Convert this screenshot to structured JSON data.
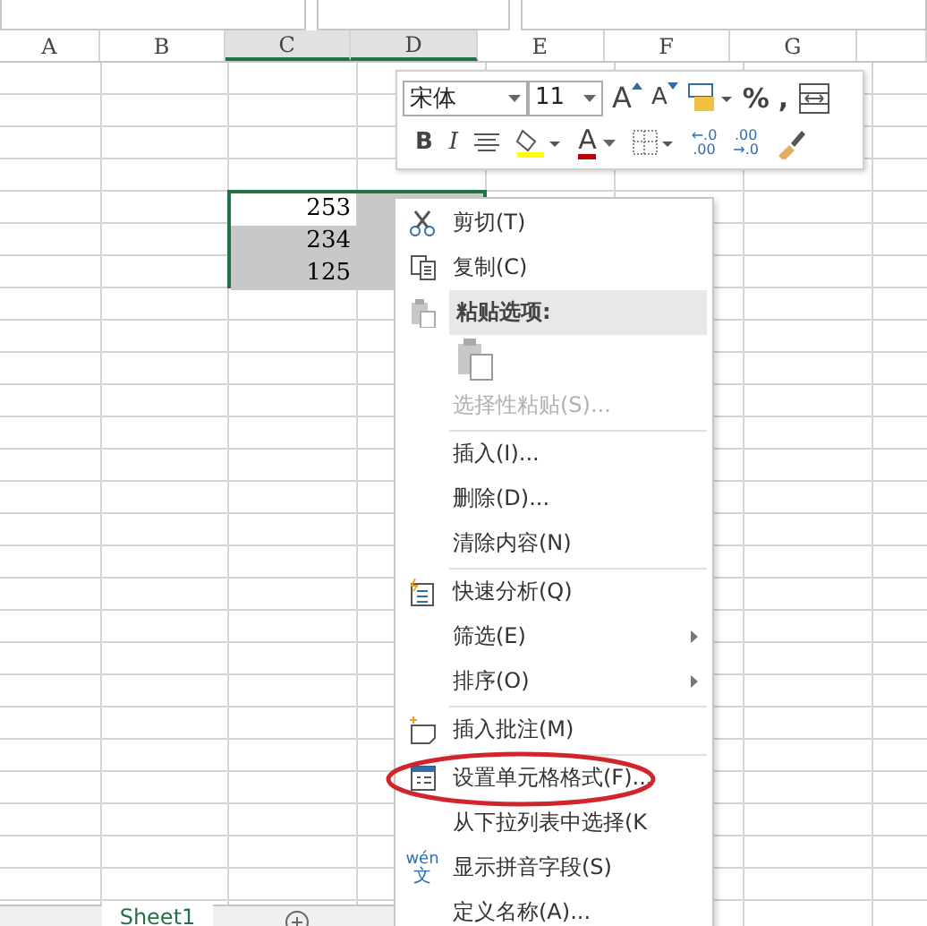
{
  "columns": [
    {
      "label": "A",
      "selected": false
    },
    {
      "label": "B",
      "selected": false
    },
    {
      "label": "C",
      "selected": true
    },
    {
      "label": "D",
      "selected": true
    },
    {
      "label": "E",
      "selected": false
    },
    {
      "label": "F",
      "selected": false
    },
    {
      "label": "G",
      "selected": false
    }
  ],
  "selected_cells": [
    {
      "value": "253",
      "active": true
    },
    {
      "value": "234",
      "active": false
    },
    {
      "value": "125",
      "active": false
    }
  ],
  "mini_toolbar": {
    "font": "宋体",
    "size": "11",
    "row_1": [
      {
        "kind": "grow",
        "label": "A"
      },
      {
        "kind": "shrink",
        "label": "A"
      },
      {
        "kind": "styles"
      },
      {
        "kind": "percent",
        "label": "%"
      },
      {
        "kind": "comma",
        "label": ","
      },
      {
        "kind": "wrap"
      }
    ],
    "row_2": [
      {
        "kind": "bold",
        "label": "B"
      },
      {
        "kind": "italic",
        "label": "I"
      },
      {
        "kind": "align"
      },
      {
        "kind": "fill"
      },
      {
        "kind": "font_color",
        "label": "A"
      },
      {
        "kind": "borders"
      },
      {
        "kind": "decimal_more",
        "top": "←.0",
        "bottom": ".00"
      },
      {
        "kind": "decimal_less",
        "top": ".00",
        "bottom": "→.0"
      },
      {
        "kind": "painter"
      }
    ]
  },
  "context_menu": [
    {
      "kind": "item",
      "label": "剪切(T)",
      "disabled": false,
      "submenu": false,
      "circled": false
    },
    {
      "kind": "item",
      "label": "复制(C)",
      "disabled": false,
      "submenu": false,
      "circled": false
    },
    {
      "kind": "header",
      "label": "粘贴选项:"
    },
    {
      "kind": "paste_option"
    },
    {
      "kind": "item",
      "label": "选择性粘贴(S)...",
      "disabled": true,
      "submenu": false,
      "circled": false
    },
    {
      "kind": "separator"
    },
    {
      "kind": "item",
      "label": "插入(I)...",
      "disabled": false,
      "submenu": false,
      "circled": false
    },
    {
      "kind": "item",
      "label": "删除(D)...",
      "disabled": false,
      "submenu": false,
      "circled": false
    },
    {
      "kind": "item",
      "label": "清除内容(N)",
      "disabled": false,
      "submenu": false,
      "circled": false
    },
    {
      "kind": "separator"
    },
    {
      "kind": "item",
      "label": "快速分析(Q)",
      "disabled": false,
      "submenu": false,
      "circled": false
    },
    {
      "kind": "item",
      "label": "筛选(E)",
      "disabled": false,
      "submenu": true,
      "circled": false
    },
    {
      "kind": "item",
      "label": "排序(O)",
      "disabled": false,
      "submenu": true,
      "circled": false
    },
    {
      "kind": "separator"
    },
    {
      "kind": "item",
      "label": "插入批注(M)",
      "disabled": false,
      "submenu": false,
      "circled": false
    },
    {
      "kind": "separator"
    },
    {
      "kind": "item",
      "label": "设置单元格格式(F)...",
      "disabled": false,
      "submenu": false,
      "circled": true
    },
    {
      "kind": "item",
      "label": "从下拉列表中选择(K",
      "disabled": false,
      "submenu": false,
      "circled": false
    },
    {
      "kind": "item",
      "label": "显示拼音字段(S)",
      "icon_text": [
        "wén",
        "文"
      ],
      "disabled": false,
      "submenu": false,
      "circled": false
    },
    {
      "kind": "item",
      "label": "定义名称(A)...",
      "disabled": false,
      "submenu": false,
      "circled": false
    }
  ],
  "sheet_tabs": [
    {
      "label": "Sheet1",
      "selected": true
    }
  ]
}
